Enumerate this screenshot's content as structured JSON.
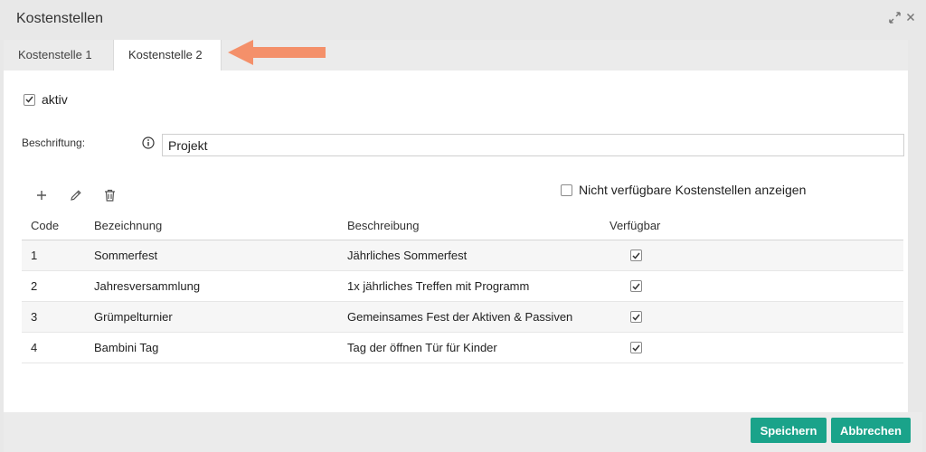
{
  "window": {
    "title": "Kostenstellen"
  },
  "tabs": [
    {
      "label": "Kostenstelle 1"
    },
    {
      "label": "Kostenstelle 2"
    }
  ],
  "form": {
    "aktiv_label": "aktiv",
    "aktiv_checked": true,
    "beschriftung_label": "Beschriftung:",
    "beschriftung_value": "Projekt"
  },
  "filter": {
    "nicht_verfuegbar_label": "Nicht verfügbare Kostenstellen anzeigen",
    "checked": false
  },
  "table": {
    "headers": {
      "code": "Code",
      "bezeichnung": "Bezeichnung",
      "beschreibung": "Beschreibung",
      "verfuegbar": "Verfügbar"
    },
    "rows": [
      {
        "code": "1",
        "bezeichnung": "Sommerfest",
        "beschreibung": "Jährliches Sommerfest",
        "verfuegbar": true
      },
      {
        "code": "2",
        "bezeichnung": "Jahresversammlung",
        "beschreibung": "1x jährliches Treffen mit Programm",
        "verfuegbar": true
      },
      {
        "code": "3",
        "bezeichnung": "Grümpelturnier",
        "beschreibung": "Gemeinsames Fest der Aktiven & Passiven",
        "verfuegbar": true
      },
      {
        "code": "4",
        "bezeichnung": "Bambini Tag",
        "beschreibung": "Tag der öffnen Tür für Kinder",
        "verfuegbar": true
      }
    ]
  },
  "buttons": {
    "save": "Speichern",
    "cancel": "Abbrechen"
  },
  "icons": {
    "add": "plus-icon",
    "edit": "pencil-icon",
    "delete": "trash-icon",
    "info": "info-icon",
    "expand": "expand-icon",
    "close": "close-icon"
  },
  "colors": {
    "accent": "#1aa38a",
    "annotation_arrow": "#f4906a"
  }
}
